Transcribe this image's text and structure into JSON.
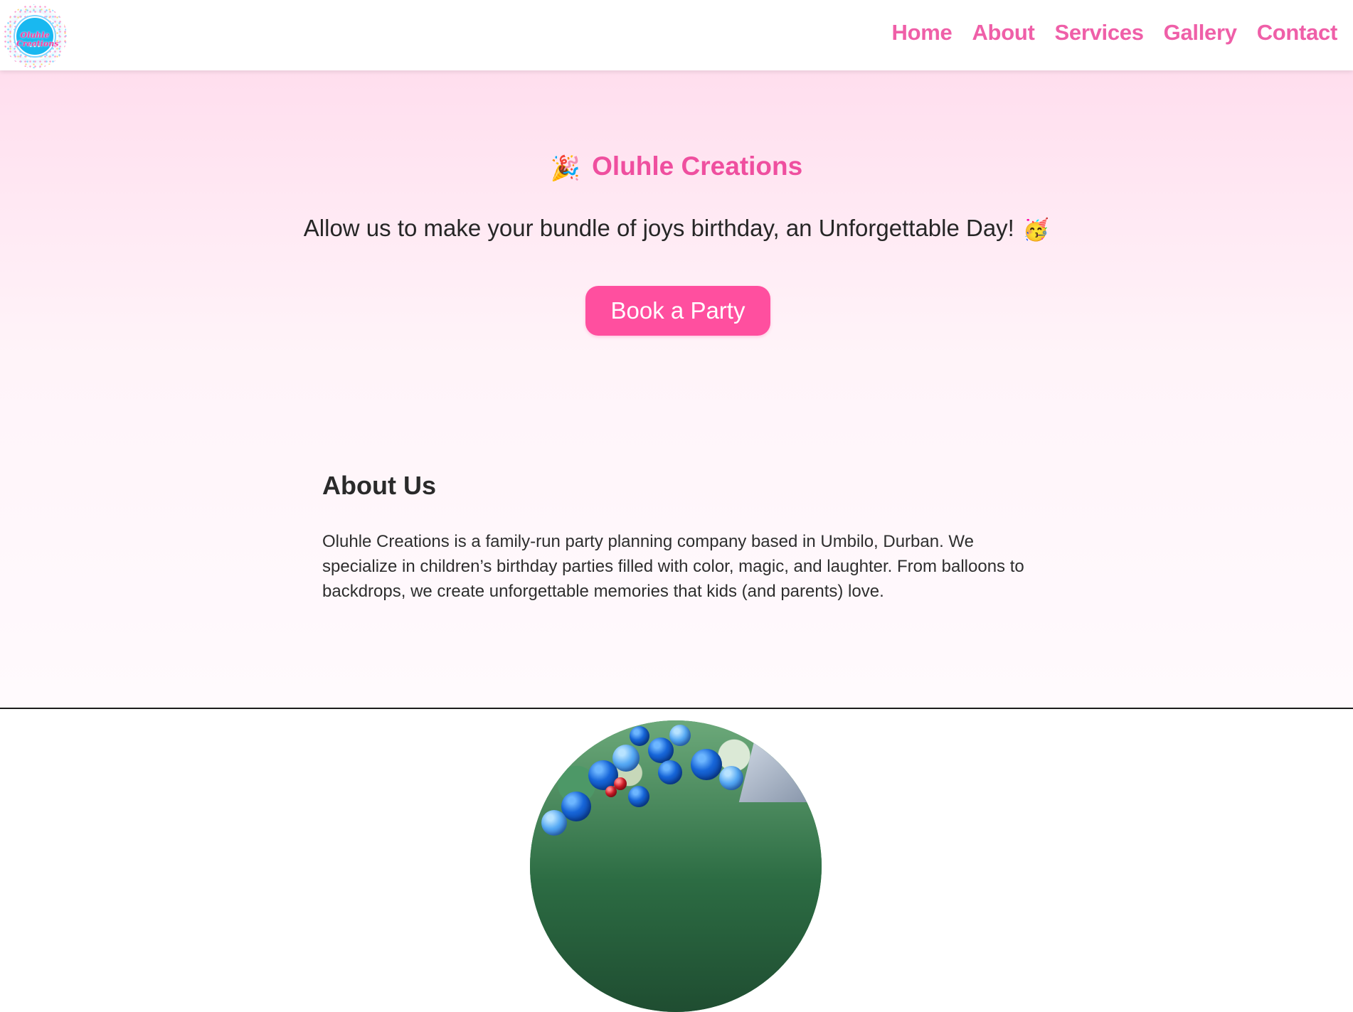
{
  "brand": {
    "logo_text": "Oluhle Creations"
  },
  "nav": {
    "items": [
      {
        "label": "Home"
      },
      {
        "label": "About"
      },
      {
        "label": "Services"
      },
      {
        "label": "Gallery"
      },
      {
        "label": "Contact"
      }
    ]
  },
  "hero": {
    "title": "Oluhle Creations",
    "title_icon": "party-popper-icon",
    "subtitle": "Allow us to make your bundle of joys birthday, an Unforgettable Day!",
    "subtitle_icon": "partying-face-icon",
    "cta_label": "Book a Party"
  },
  "about": {
    "heading": "About Us",
    "text": "Oluhle Creations is a family-run party planning company based in Umbilo, Durban. We specialize in children’s birthday parties filled with color, magic, and laughter. From balloons to backdrops, we create unforgettable memories that kids (and parents) love."
  },
  "colors": {
    "accent": "#ef5fa8",
    "button": "#ff4f9f",
    "hero_bg_top": "#ffdeee",
    "hero_bg_bottom": "#fffafd",
    "text": "#2a2a2a"
  }
}
